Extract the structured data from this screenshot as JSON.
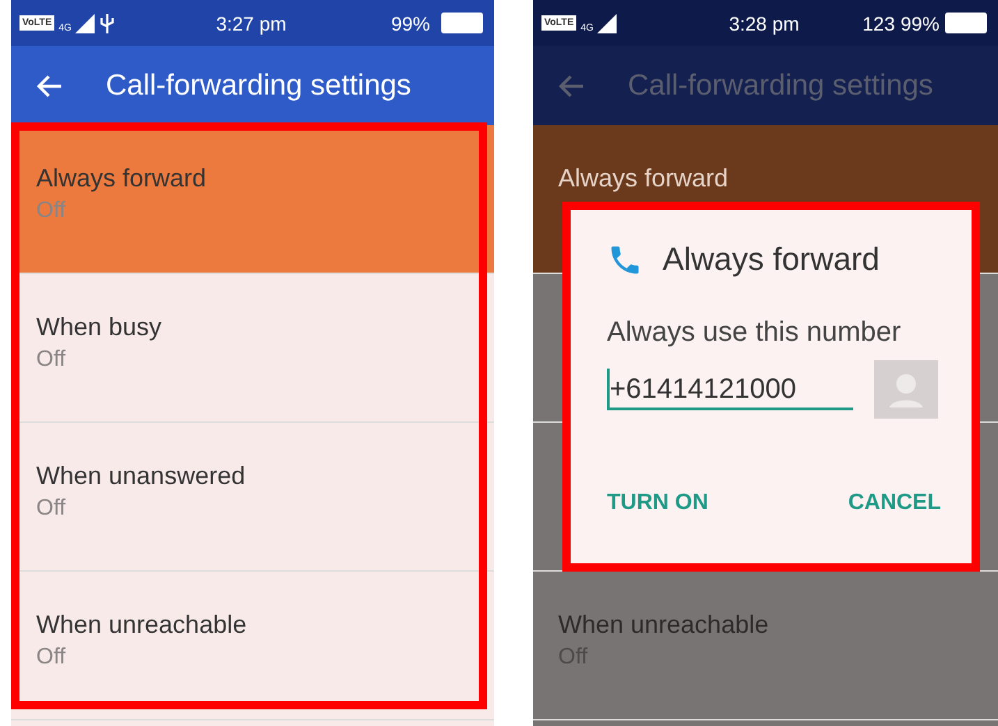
{
  "screens": [
    {
      "dimmed": false,
      "status_bar": {
        "network": "VoLTE",
        "network_type": "4G",
        "usb_connected": true,
        "time": "3:27 pm",
        "battery": "99%"
      },
      "app_bar": {
        "title": "Call-forwarding settings"
      },
      "items": [
        {
          "label": "Always forward",
          "value": "Off",
          "selected": true
        },
        {
          "label": "When busy",
          "value": "Off",
          "selected": false
        },
        {
          "label": "When unanswered",
          "value": "Off",
          "selected": false
        },
        {
          "label": "When unreachable",
          "value": "Off",
          "selected": false
        }
      ],
      "highlight": {
        "kind": "list"
      }
    },
    {
      "dimmed": true,
      "status_bar": {
        "network": "VoLTE",
        "network_type": "4G",
        "usb_connected": false,
        "time": "3:28 pm",
        "data_counter": "123",
        "battery": "99%"
      },
      "app_bar": {
        "title": "Call-forwarding settings"
      },
      "items": [
        {
          "label": "Always forward",
          "selected": true
        },
        {
          "selected": false
        },
        {
          "selected": false
        },
        {
          "label": "When unreachable",
          "value": "Off",
          "selected": false
        }
      ],
      "dialog": {
        "title": "Always forward",
        "message": "Always use this number",
        "number": "+61414121000",
        "buttons": [
          "TURN ON",
          "CANCEL"
        ]
      },
      "highlight": {
        "kind": "dialog"
      }
    }
  ]
}
